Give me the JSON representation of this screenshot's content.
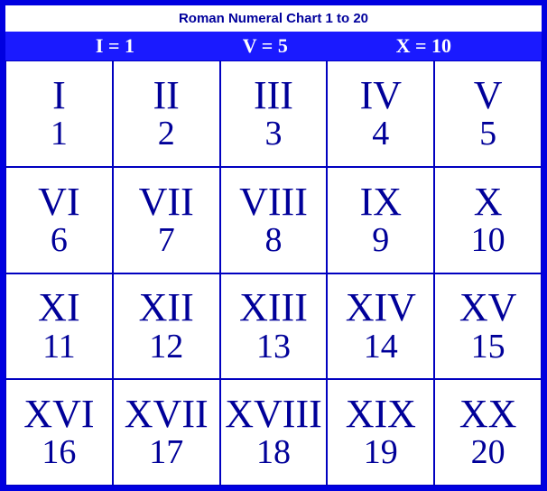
{
  "title": "Roman Numeral Chart 1 to 20",
  "legend": [
    {
      "text": "I = 1"
    },
    {
      "text": "V = 5"
    },
    {
      "text": "X = 10"
    }
  ],
  "cells": [
    {
      "roman": "I",
      "arabic": "1"
    },
    {
      "roman": "II",
      "arabic": "2"
    },
    {
      "roman": "III",
      "arabic": "3"
    },
    {
      "roman": "IV",
      "arabic": "4"
    },
    {
      "roman": "V",
      "arabic": "5"
    },
    {
      "roman": "VI",
      "arabic": "6"
    },
    {
      "roman": "VII",
      "arabic": "7"
    },
    {
      "roman": "VIII",
      "arabic": "8"
    },
    {
      "roman": "IX",
      "arabic": "9"
    },
    {
      "roman": "X",
      "arabic": "10"
    },
    {
      "roman": "XI",
      "arabic": "11"
    },
    {
      "roman": "XII",
      "arabic": "12"
    },
    {
      "roman": "XIII",
      "arabic": "13"
    },
    {
      "roman": "XIV",
      "arabic": "14"
    },
    {
      "roman": "XV",
      "arabic": "15"
    },
    {
      "roman": "XVI",
      "arabic": "16"
    },
    {
      "roman": "XVII",
      "arabic": "17"
    },
    {
      "roman": "XVIII",
      "arabic": "18"
    },
    {
      "roman": "XIX",
      "arabic": "19"
    },
    {
      "roman": "XX",
      "arabic": "20"
    }
  ],
  "chart_data": {
    "type": "table",
    "title": "Roman Numeral Chart 1 to 20",
    "legend": [
      "I = 1",
      "V = 5",
      "X = 10"
    ],
    "columns": [
      "roman",
      "arabic"
    ],
    "rows": [
      [
        "I",
        1
      ],
      [
        "II",
        2
      ],
      [
        "III",
        3
      ],
      [
        "IV",
        4
      ],
      [
        "V",
        5
      ],
      [
        "VI",
        6
      ],
      [
        "VII",
        7
      ],
      [
        "VIII",
        8
      ],
      [
        "IX",
        9
      ],
      [
        "X",
        10
      ],
      [
        "XI",
        11
      ],
      [
        "XII",
        12
      ],
      [
        "XIII",
        13
      ],
      [
        "XIV",
        14
      ],
      [
        "XV",
        15
      ],
      [
        "XVI",
        16
      ],
      [
        "XVII",
        17
      ],
      [
        "XVIII",
        18
      ],
      [
        "XIX",
        19
      ],
      [
        "XX",
        20
      ]
    ]
  }
}
